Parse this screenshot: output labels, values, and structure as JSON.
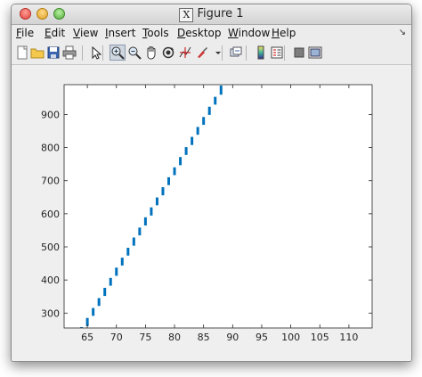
{
  "window": {
    "title": "Figure 1"
  },
  "menu": [
    {
      "name": "file",
      "pre": "",
      "acc": "F",
      "post": "ile"
    },
    {
      "name": "edit",
      "pre": "",
      "acc": "E",
      "post": "dit"
    },
    {
      "name": "view",
      "pre": "",
      "acc": "V",
      "post": "iew"
    },
    {
      "name": "insert",
      "pre": "",
      "acc": "I",
      "post": "nsert"
    },
    {
      "name": "tools",
      "pre": "",
      "acc": "T",
      "post": "ools"
    },
    {
      "name": "desktop",
      "pre": "",
      "acc": "D",
      "post": "esktop"
    },
    {
      "name": "window",
      "pre": "",
      "acc": "W",
      "post": "indow"
    },
    {
      "name": "help",
      "pre": "",
      "acc": "H",
      "post": "elp"
    }
  ],
  "toolbar": {
    "buttons": [
      {
        "name": "new-figure-icon"
      },
      {
        "name": "open-file-icon"
      },
      {
        "name": "save-icon"
      },
      {
        "name": "print-icon"
      },
      {
        "name": "edit-plot-arrow-icon"
      },
      {
        "name": "zoom-in-icon"
      },
      {
        "name": "zoom-out-icon"
      },
      {
        "name": "pan-hand-icon"
      },
      {
        "name": "rotate-3d-icon"
      },
      {
        "name": "data-cursor-icon"
      },
      {
        "name": "brush-icon"
      },
      {
        "name": "brush-dropdown-icon"
      },
      {
        "name": "link-plot-icon"
      },
      {
        "name": "insert-colorbar-icon"
      },
      {
        "name": "insert-legend-icon"
      },
      {
        "name": "hide-plot-tools-icon"
      },
      {
        "name": "show-plot-tools-icon"
      }
    ],
    "pressed": "zoom-in-icon"
  },
  "chart_data": {
    "type": "scatter",
    "title": "",
    "xlabel": "",
    "ylabel": "",
    "xlim": [
      61,
      114
    ],
    "ylim": [
      255,
      990
    ],
    "xticks": [
      65,
      70,
      75,
      80,
      85,
      90,
      95,
      100,
      105,
      110
    ],
    "yticks": [
      300,
      400,
      500,
      600,
      700,
      800,
      900
    ],
    "grid": false,
    "marker": "vertical-bar",
    "color": "#0072bd",
    "series": [
      {
        "x": [
          64,
          65,
          66,
          67,
          68,
          69,
          70,
          71,
          72,
          73,
          74,
          75,
          76,
          77,
          78,
          79,
          80,
          81,
          82,
          83,
          84,
          85,
          86,
          87,
          88
        ],
        "y_low": [
          255,
          258,
          289,
          319,
          349,
          380,
          410,
          441,
          471,
          501,
          532,
          562,
          592,
          623,
          653,
          684,
          714,
          744,
          775,
          805,
          836,
          866,
          896,
          927,
          957
        ],
        "y_high": [
          258,
          288,
          318,
          348,
          379,
          409,
          440,
          470,
          500,
          531,
          561,
          592,
          622,
          652,
          683,
          713,
          743,
          774,
          804,
          835,
          865,
          895,
          926,
          956,
          990
        ]
      }
    ]
  }
}
